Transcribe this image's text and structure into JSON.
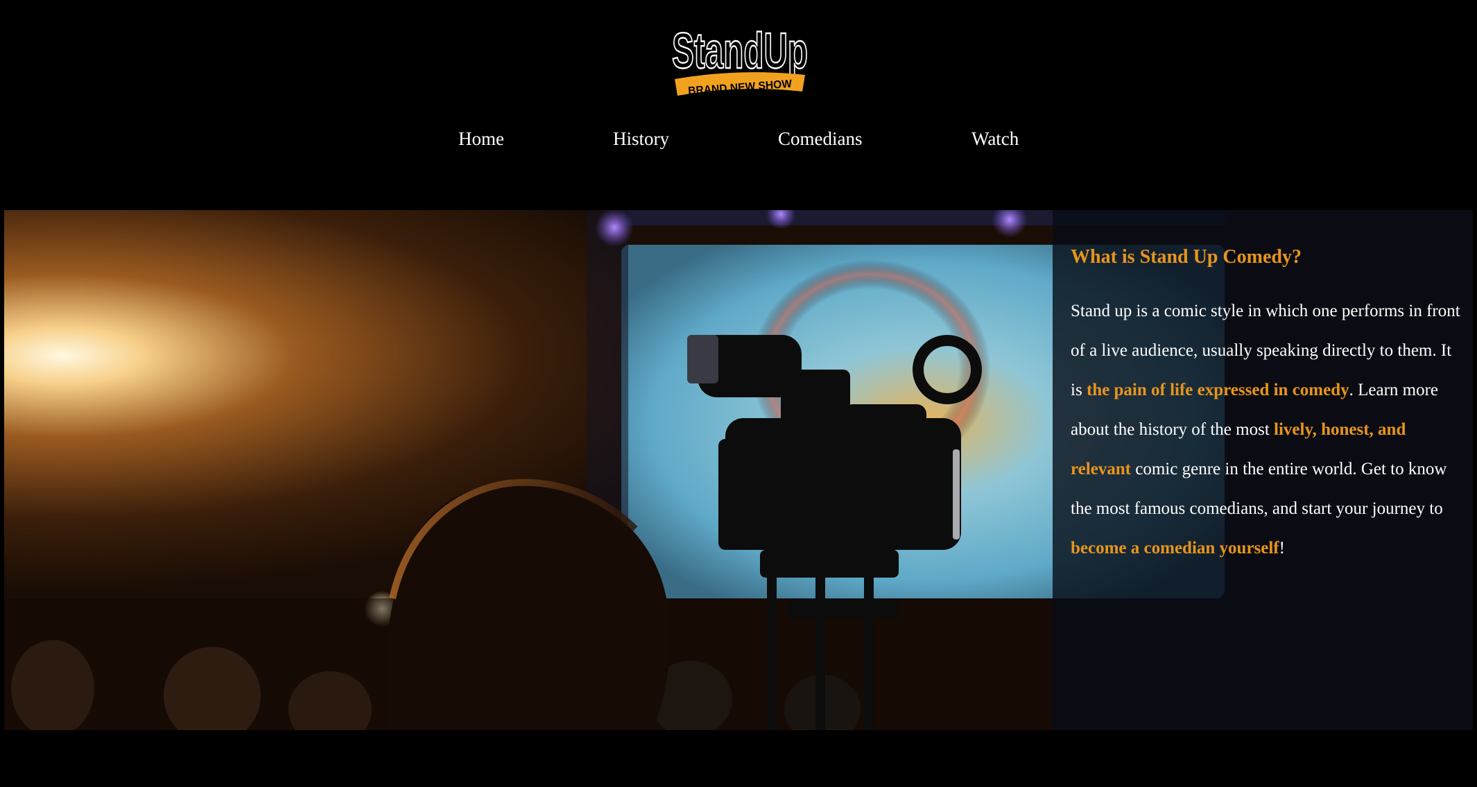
{
  "logo": {
    "title": "StandUp",
    "tagline": "BRAND NEW SHOW"
  },
  "nav": {
    "items": [
      "Home",
      "History",
      "Comedians",
      "Watch"
    ]
  },
  "hero": {
    "heading": "What is Stand Up Comedy?",
    "paragraph": [
      {
        "text": "Stand up is a comic style in which one performs in front of a live audience, usually speaking directly to them. It is ",
        "highlight": false
      },
      {
        "text": "the pain of life expressed in comedy",
        "highlight": true
      },
      {
        "text": ". Learn more about the history of the most ",
        "highlight": false
      },
      {
        "text": "lively, honest, and relevant",
        "highlight": true
      },
      {
        "text": " comic genre in the entire world. Get to know the most famous comedians, and start your journey to ",
        "highlight": false
      },
      {
        "text": "become a comedian yourself",
        "highlight": true
      },
      {
        "text": "!",
        "highlight": false
      }
    ]
  },
  "colors": {
    "background": "#000000",
    "accent": "#e8951c",
    "text": "#ffffff"
  },
  "icons": [
    "camera-photo",
    "standup-logo"
  ]
}
